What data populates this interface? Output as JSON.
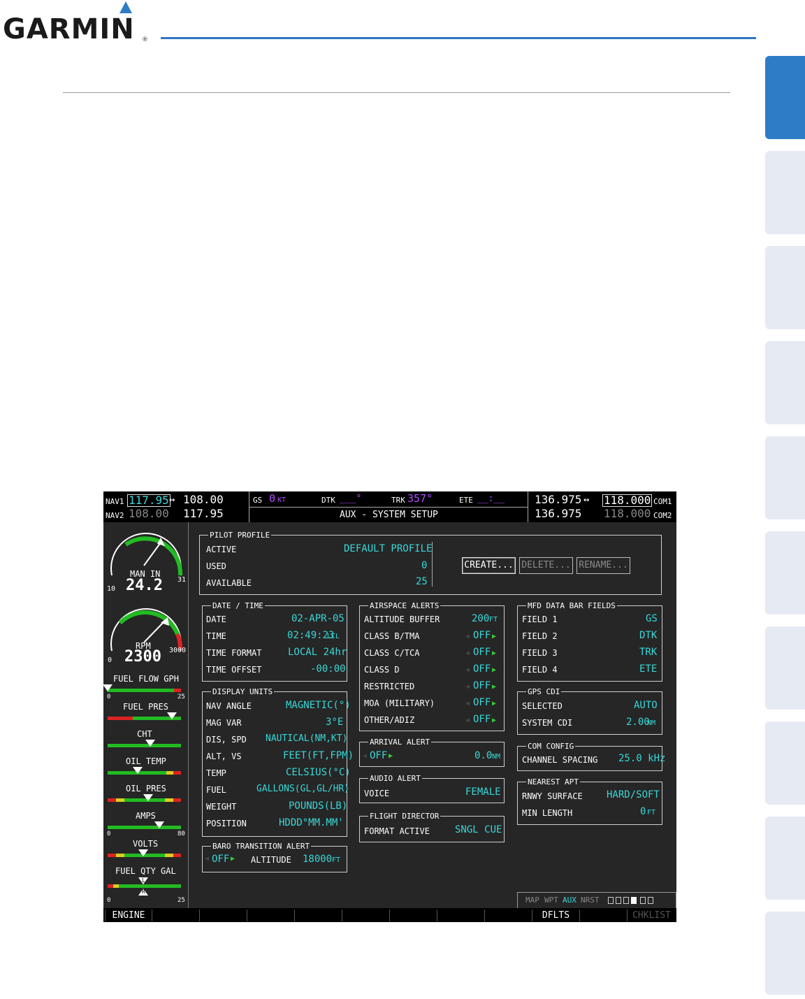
{
  "brand": {
    "logo_text": "GARMIN",
    "reg_mark": "®"
  },
  "mfd": {
    "top": {
      "nav1_label": "NAV1",
      "nav1_active": "117.95",
      "nav1_arrow": "↔",
      "nav1_standby": "108.00",
      "nav2_label": "NAV2",
      "nav2_active": "108.00",
      "nav2_standby": "117.95",
      "gs_label": "GS",
      "gs_value": "0",
      "gs_unit": "KT",
      "dtk_label": "DTK",
      "dtk_value": "___°",
      "trk_label": "TRK",
      "trk_value": "357°",
      "ete_label": "ETE",
      "ete_value": "__:__",
      "page_title": "AUX - SYSTEM SETUP",
      "com1_standby": "136.975",
      "com1_arrow": "↔",
      "com1_active": "118.000",
      "com1_label": "COM1",
      "com2_standby": "136.975",
      "com2_active": "118.000",
      "com2_label": "COM2"
    },
    "engine": {
      "man_in_label": "MAN IN",
      "man_in_value": "24.2",
      "man_in_min": "10",
      "man_in_max": "31",
      "rpm_label": "RPM",
      "rpm_value": "2300",
      "rpm_min": "0",
      "rpm_max": "3000",
      "fuel_flow_label": "FUEL FLOW GPH",
      "fuel_flow_min": "0",
      "fuel_flow_max": "25",
      "fuel_flow_level": 0.0,
      "fuel_pres_label": "FUEL PRES",
      "fuel_pres_level": 0.88,
      "cht_label": "CHT",
      "cht_level": 0.58,
      "oil_temp_label": "OIL TEMP",
      "oil_temp_level": 0.41,
      "oil_pres_label": "OIL PRES",
      "oil_pres_level": 0.55,
      "amps_label": "AMPS",
      "amps_min": "0",
      "amps_max": "80",
      "amps_level": 0.7,
      "volts_label": "VOLTS",
      "volts_level": 0.49,
      "fuel_qty_label": "FUEL QTY GAL",
      "fuel_qty_min": "0",
      "fuel_qty_max": "25",
      "fuel_qty_level": 0.49,
      "fuel_qty_left": "L",
      "fuel_qty_right": "R"
    },
    "pilot_profile": {
      "title": "PILOT PROFILE",
      "active_label": "ACTIVE",
      "active_value": "DEFAULT PROFILE",
      "used_label": "USED",
      "used_value": "0",
      "available_label": "AVAILABLE",
      "available_value": "25",
      "create_label": "CREATE...",
      "delete_label": "DELETE...",
      "rename_label": "RENAME..."
    },
    "date_time": {
      "title": "DATE / TIME",
      "date_label": "DATE",
      "date_value": "02-APR-05",
      "time_label": "TIME",
      "time_value": "02:49:23",
      "time_suffix": "LCL",
      "format_label": "TIME FORMAT",
      "format_value": "LOCAL 24hr",
      "offset_label": "TIME OFFSET",
      "offset_value": "-00:00"
    },
    "display_units": {
      "title": "DISPLAY UNITS",
      "rows": [
        {
          "label": "NAV ANGLE",
          "value": "MAGNETIC(°)"
        },
        {
          "label": "MAG VAR",
          "value": "3°E"
        },
        {
          "label": "DIS, SPD",
          "value": "NAUTICAL(NM,KT)"
        },
        {
          "label": "ALT, VS",
          "value": "FEET(FT,FPM)"
        },
        {
          "label": "TEMP",
          "value": "CELSIUS(°C)"
        },
        {
          "label": "FUEL",
          "value": "GALLONS(GL,GL/HR)"
        },
        {
          "label": "WEIGHT",
          "value": "POUNDS(LB)"
        },
        {
          "label": "POSITION",
          "value": "HDDD°MM.MM'"
        }
      ]
    },
    "baro": {
      "title": "BARO TRANSITION ALERT",
      "state": "OFF",
      "alt_label": "ALTITUDE",
      "alt_value": "18000",
      "alt_unit": "FT"
    },
    "airspace": {
      "title": "AIRSPACE ALERTS",
      "buffer_label": "ALTITUDE BUFFER",
      "buffer_value": "200",
      "buffer_unit": "FT",
      "rows": [
        {
          "label": "CLASS B/TMA",
          "value": "OFF"
        },
        {
          "label": "CLASS C/TCA",
          "value": "OFF"
        },
        {
          "label": "CLASS D",
          "value": "OFF"
        },
        {
          "label": "RESTRICTED",
          "value": "OFF"
        },
        {
          "label": "MOA (MILITARY)",
          "value": "OFF"
        },
        {
          "label": "OTHER/ADIZ",
          "value": "OFF"
        }
      ]
    },
    "arrival": {
      "title": "ARRIVAL ALERT",
      "state": "OFF",
      "value": "0.0",
      "unit": "NM"
    },
    "audio": {
      "title": "AUDIO ALERT",
      "voice_label": "VOICE",
      "voice_value": "FEMALE"
    },
    "flight_director": {
      "title": "FLIGHT DIRECTOR",
      "label": "FORMAT ACTIVE",
      "value": "SNGL CUE"
    },
    "data_bar": {
      "title": "MFD DATA BAR FIELDS",
      "rows": [
        {
          "label": "FIELD 1",
          "value": "GS"
        },
        {
          "label": "FIELD 2",
          "value": "DTK"
        },
        {
          "label": "FIELD 3",
          "value": "TRK"
        },
        {
          "label": "FIELD 4",
          "value": "ETE"
        }
      ]
    },
    "gps_cdi": {
      "title": "GPS CDI",
      "selected_label": "SELECTED",
      "selected_value": "AUTO",
      "system_label": "SYSTEM CDI",
      "system_value": "2.00",
      "system_unit": "NM"
    },
    "com_config": {
      "title": "COM CONFIG",
      "label": "CHANNEL SPACING",
      "value": "25.0 kHz"
    },
    "nearest_apt": {
      "title": "NEAREST APT",
      "surface_label": "RNWY SURFACE",
      "surface_value": "HARD/SOFT",
      "length_label": "MIN LENGTH",
      "length_value": "0",
      "length_unit": "FT"
    },
    "page_groups": {
      "map": "MAP",
      "wpt": "WPT",
      "aux": "AUX",
      "nrst": "NRST"
    },
    "softkeys": [
      "ENGINE",
      "",
      "",
      "",
      "",
      "",
      "",
      "",
      "",
      "DFLTS",
      "",
      "CHKLIST"
    ]
  }
}
